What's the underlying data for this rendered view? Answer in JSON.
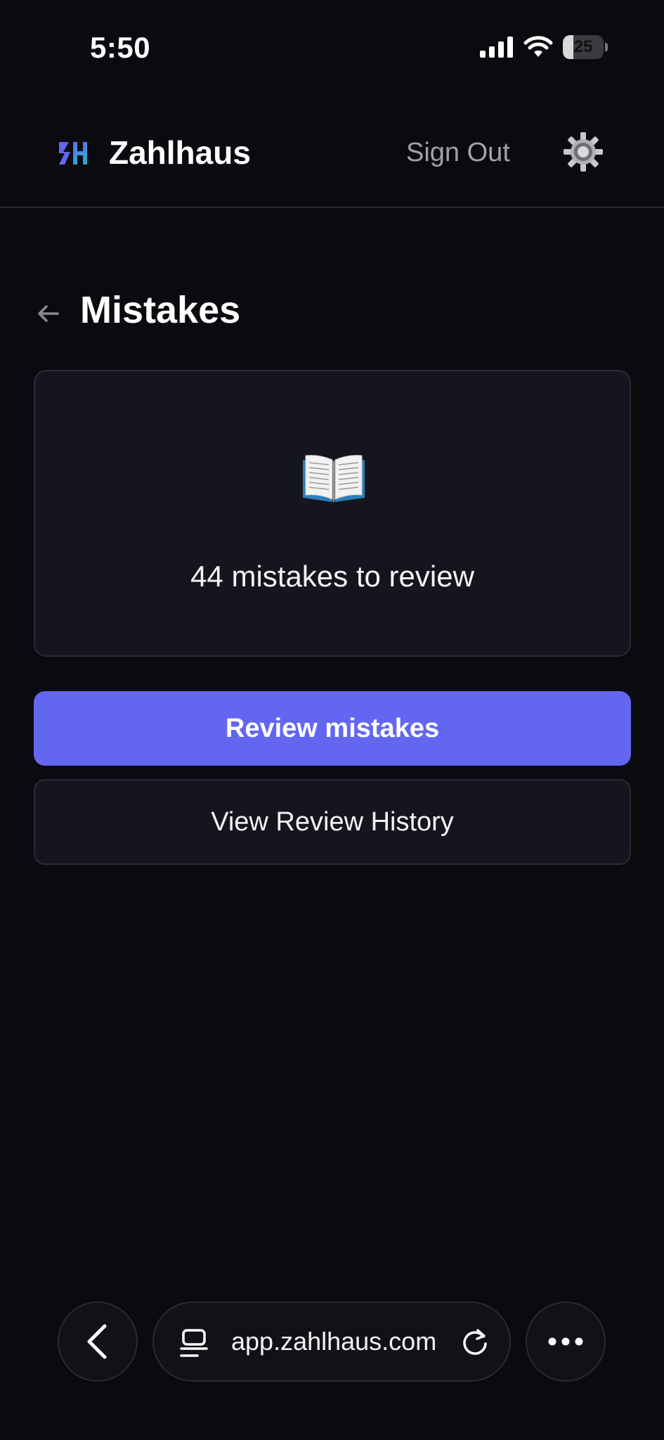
{
  "status_bar": {
    "time": "5:50",
    "battery_level": "25",
    "battery_fraction": 0.25,
    "icons": [
      "cellular-signal-icon",
      "wifi-icon",
      "battery-icon"
    ]
  },
  "header": {
    "app_name": "Zahlhaus",
    "logo_icon": "zahlhaus-logo-icon",
    "sign_out_label": "Sign Out",
    "settings_icon": "gear-icon"
  },
  "page": {
    "title": "Mistakes",
    "back_icon": "arrow-left-icon"
  },
  "summary": {
    "icon": "open-book-icon",
    "text": "44 mistakes to review"
  },
  "actions": {
    "review_label": "Review mistakes",
    "history_label": "View Review History"
  },
  "browser": {
    "url": "app.zahlhaus.com",
    "icons": [
      "chevron-left-icon",
      "tabs-icon",
      "reload-icon",
      "more-icon"
    ]
  },
  "colors": {
    "background": "#0a0a0f",
    "card": "#15151f",
    "border": "#2a2a33",
    "accent": "#6366f1",
    "muted_text": "#a1a1aa"
  }
}
